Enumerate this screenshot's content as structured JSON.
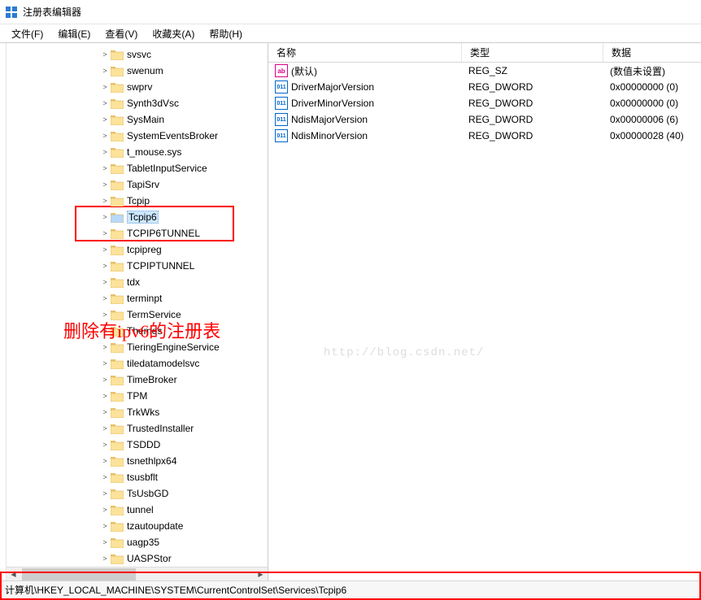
{
  "window": {
    "title": "注册表编辑器"
  },
  "menu": {
    "file": "文件(F)",
    "edit": "编辑(E)",
    "view": "查看(V)",
    "favorites": "收藏夹(A)",
    "help": "帮助(H)"
  },
  "tree": {
    "items": [
      {
        "label": "svsvc"
      },
      {
        "label": "swenum"
      },
      {
        "label": "swprv"
      },
      {
        "label": "Synth3dVsc"
      },
      {
        "label": "SysMain"
      },
      {
        "label": "SystemEventsBroker"
      },
      {
        "label": "t_mouse.sys"
      },
      {
        "label": "TabletInputService"
      },
      {
        "label": "TapiSrv"
      },
      {
        "label": "Tcpip"
      },
      {
        "label": "Tcpip6",
        "selected": true
      },
      {
        "label": "TCPIP6TUNNEL"
      },
      {
        "label": "tcpipreg"
      },
      {
        "label": "TCPIPTUNNEL"
      },
      {
        "label": "tdx"
      },
      {
        "label": "terminpt"
      },
      {
        "label": "TermService"
      },
      {
        "label": "Themes"
      },
      {
        "label": "TieringEngineService"
      },
      {
        "label": "tiledatamodelsvc"
      },
      {
        "label": "TimeBroker"
      },
      {
        "label": "TPM"
      },
      {
        "label": "TrkWks"
      },
      {
        "label": "TrustedInstaller"
      },
      {
        "label": "TSDDD"
      },
      {
        "label": "tsnethlpx64"
      },
      {
        "label": "tsusbflt"
      },
      {
        "label": "TsUsbGD"
      },
      {
        "label": "tunnel"
      },
      {
        "label": "tzautoupdate"
      },
      {
        "label": "uagp35"
      },
      {
        "label": "UASPStor"
      }
    ]
  },
  "list": {
    "headers": {
      "name": "名称",
      "type": "类型",
      "data": "数据"
    },
    "rows": [
      {
        "icon": "str",
        "name": "(默认)",
        "type": "REG_SZ",
        "data": "(数值未设置)"
      },
      {
        "icon": "dword",
        "name": "DriverMajorVersion",
        "type": "REG_DWORD",
        "data": "0x00000000 (0)"
      },
      {
        "icon": "dword",
        "name": "DriverMinorVersion",
        "type": "REG_DWORD",
        "data": "0x00000000 (0)"
      },
      {
        "icon": "dword",
        "name": "NdisMajorVersion",
        "type": "REG_DWORD",
        "data": "0x00000006 (6)"
      },
      {
        "icon": "dword",
        "name": "NdisMinorVersion",
        "type": "REG_DWORD",
        "data": "0x00000028 (40)"
      }
    ]
  },
  "statusbar": {
    "path": "计算机\\HKEY_LOCAL_MACHINE\\SYSTEM\\CurrentControlSet\\Services\\Tcpip6"
  },
  "annotation": {
    "text": "删除有ipv6的注册表"
  },
  "watermark": {
    "text": "http://blog.csdn.net/"
  },
  "icons": {
    "str_label": "ab",
    "dword_label": "011"
  }
}
